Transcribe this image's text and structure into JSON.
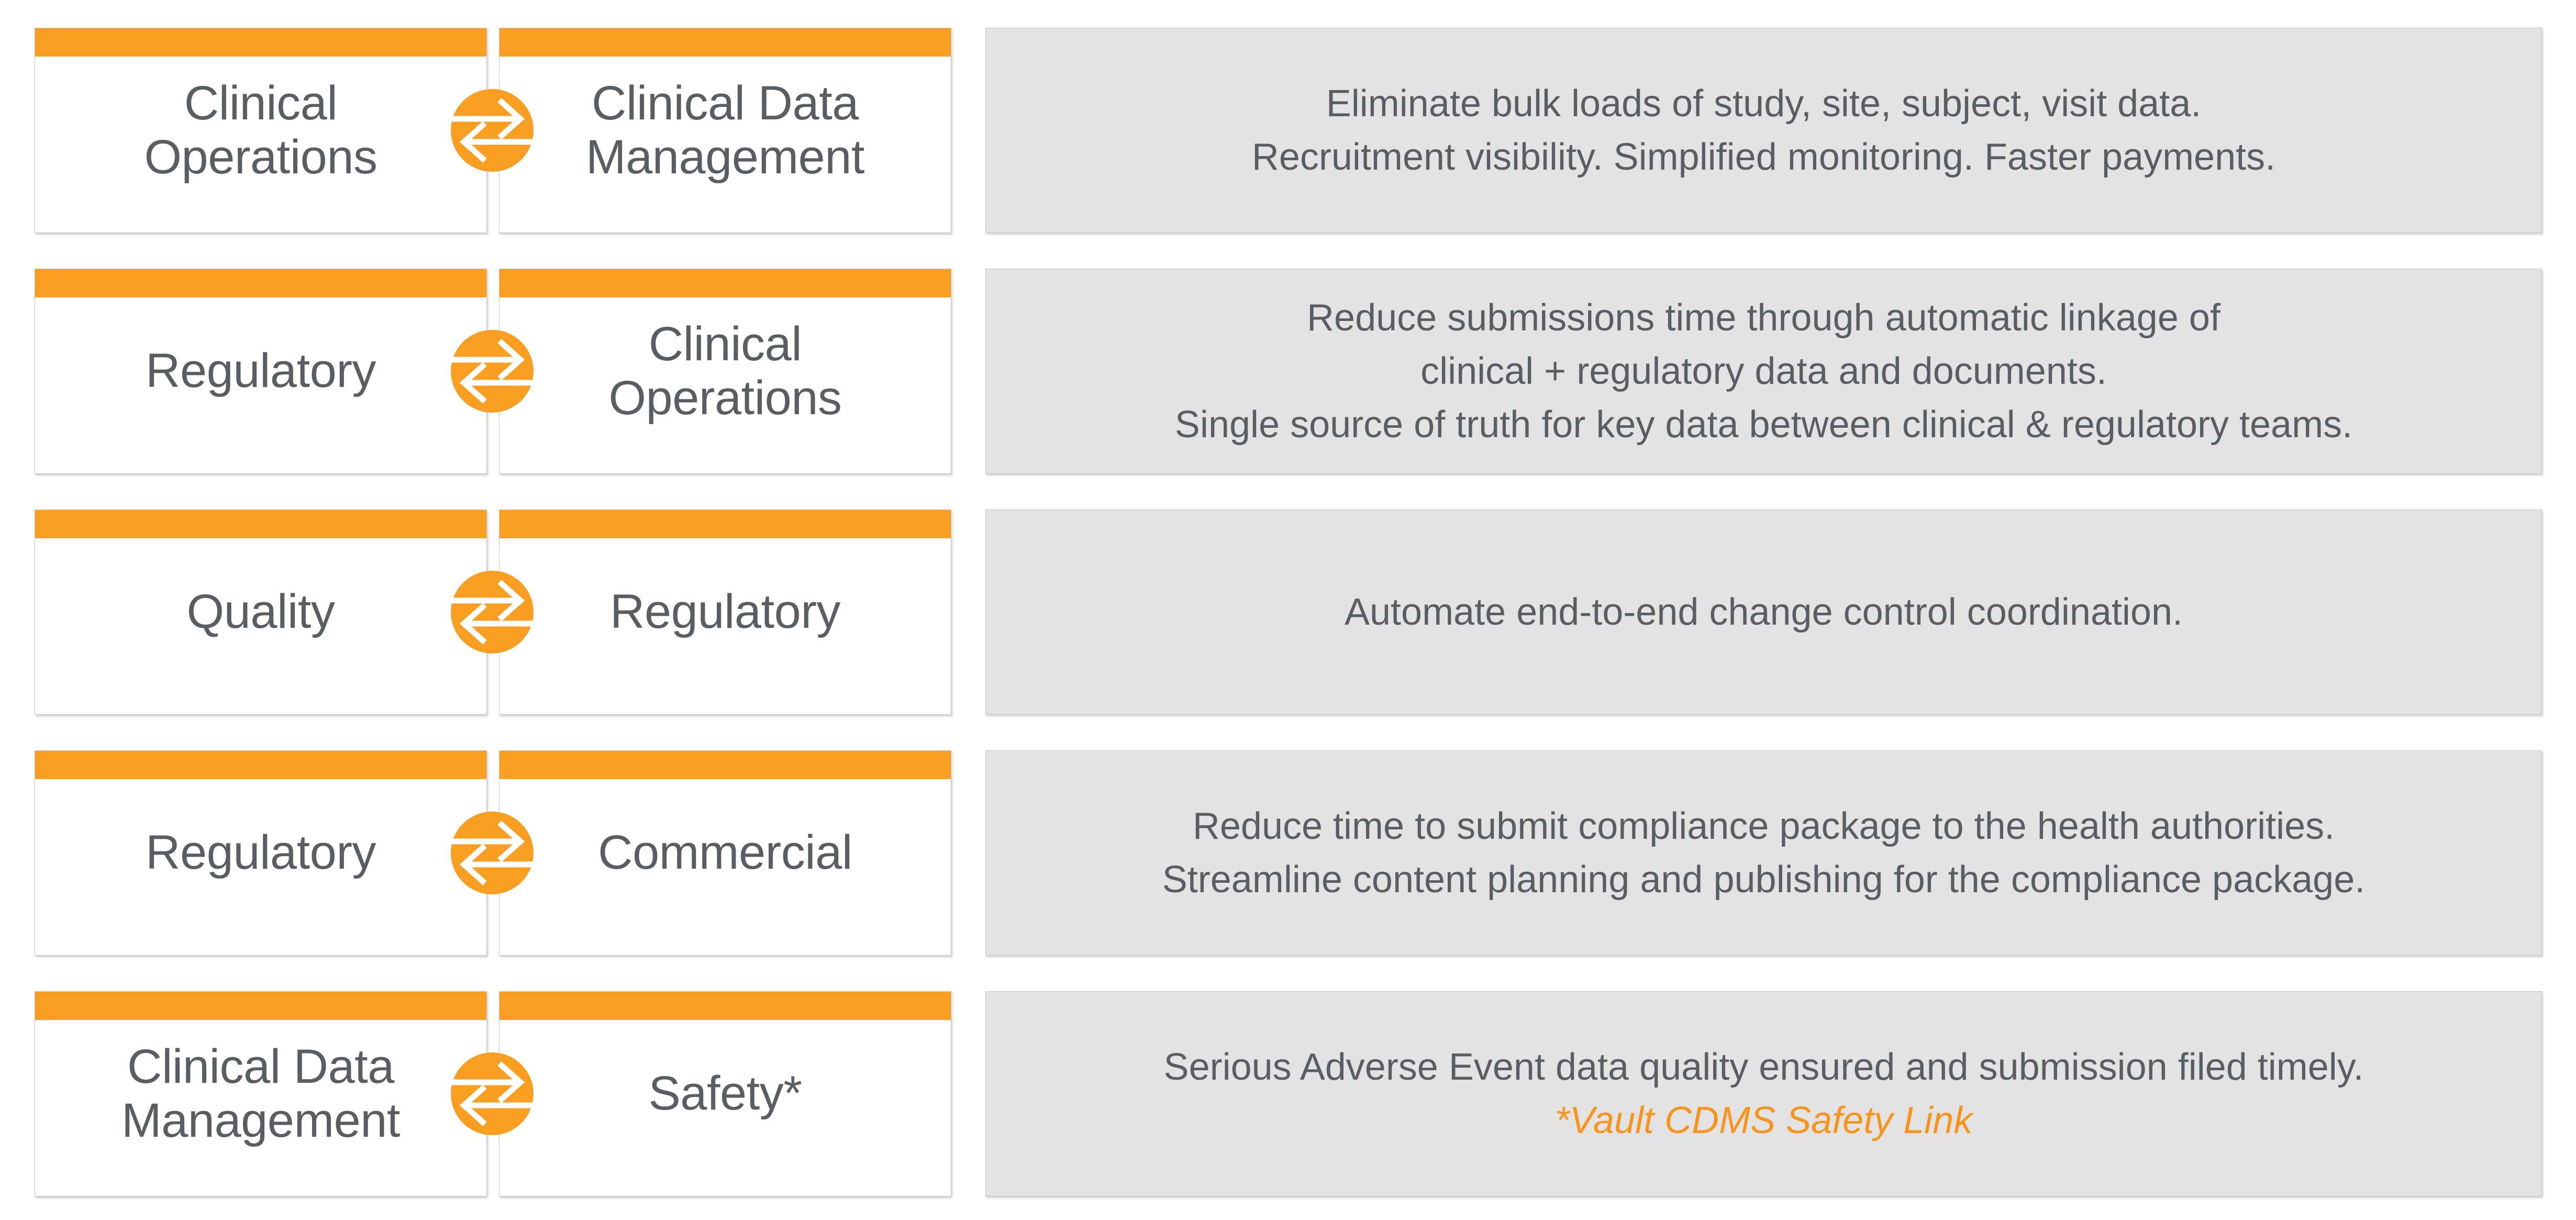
{
  "theme": {
    "accent_orange": "#FA9E21",
    "note_orange": "#F7941E",
    "text_gray": "#5A5D61",
    "panel_gray": "#E3E3E3",
    "card_white": "#FFFFFF",
    "border_gray": "#C7C7C7"
  },
  "icon": {
    "exchange": "exchange-arrows-icon"
  },
  "rows": [
    {
      "left_card": "Clinical\nOperations",
      "right_card": "Clinical Data\nManagement",
      "description_lines": [
        "Eliminate bulk loads of study, site, subject, visit data.",
        "Recruitment visibility. Simplified monitoring. Faster payments."
      ],
      "note": ""
    },
    {
      "left_card": "Regulatory",
      "right_card": "Clinical\nOperations",
      "description_lines": [
        "Reduce submissions time through automatic linkage of",
        "clinical + regulatory data and documents.",
        "Single source of truth for key data between clinical & regulatory teams."
      ],
      "note": ""
    },
    {
      "left_card": "Quality",
      "right_card": "Regulatory",
      "description_lines": [
        "Automate end-to-end change control coordination."
      ],
      "note": ""
    },
    {
      "left_card": "Regulatory",
      "right_card": "Commercial",
      "description_lines": [
        "Reduce time to submit compliance package to the health authorities.",
        "Streamline content planning and publishing for the compliance package."
      ],
      "note": ""
    },
    {
      "left_card": "Clinical Data\nManagement",
      "right_card": "Safety*",
      "description_lines": [
        "Serious Adverse Event data quality ensured and submission filed timely."
      ],
      "note": "*Vault CDMS Safety Link"
    }
  ]
}
